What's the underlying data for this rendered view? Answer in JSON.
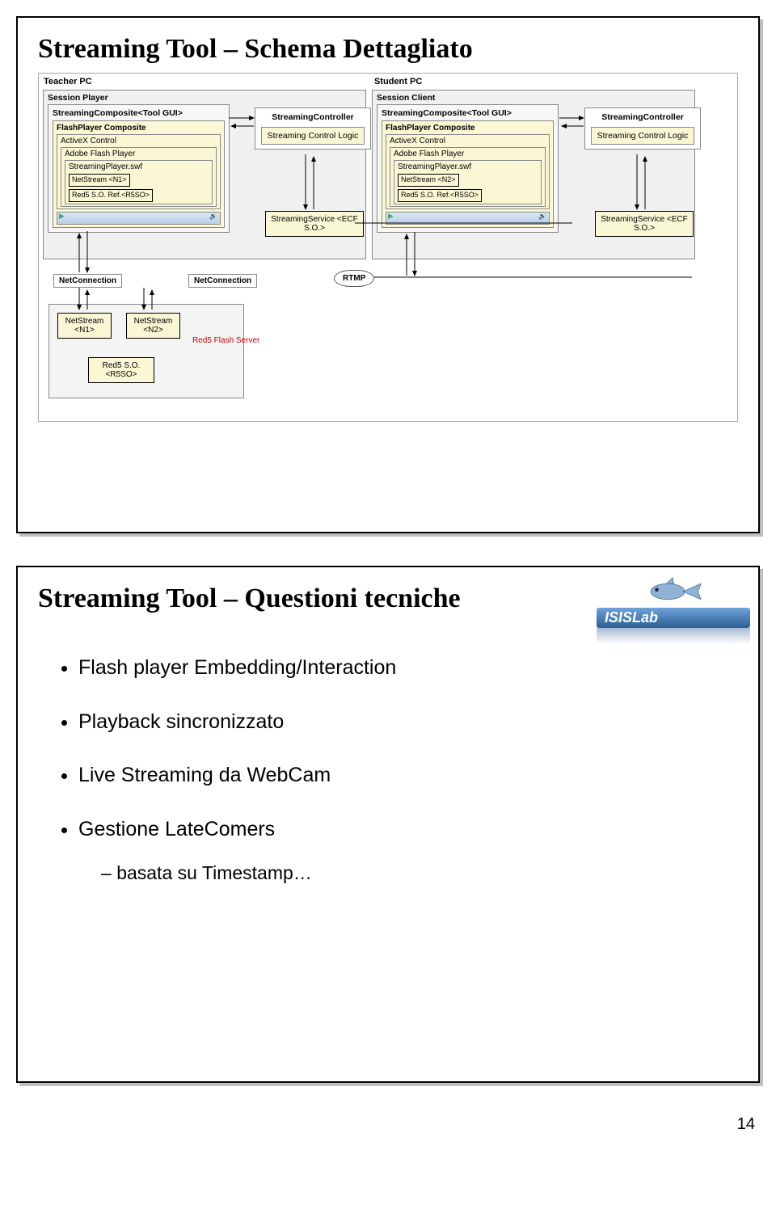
{
  "slide1": {
    "title": "Streaming Tool – Schema Dettagliato",
    "teacher_pc": "Teacher PC",
    "student_pc": "Student PC",
    "session_player": "Session Player",
    "session_client": "Session Client",
    "composite": "StreamingComposite<Tool GUI>",
    "flash_composite": "FlashPlayer Composite",
    "activex": "ActiveX Control",
    "flash_player": "Adobe Flash Player",
    "swf": "StreamingPlayer.swf",
    "netstream_n1": "NetStream <N1>",
    "netstream_n2": "NetStream <N2>",
    "red5_ref": "Red5 S.O. Ref.<R5SO>",
    "controller": "StreamingController",
    "control_logic": "Streaming Control Logic",
    "service": "StreamingService <ECF S.O.>",
    "netconnection": "NetConnection",
    "rtmp": "RTMP",
    "red5_so": "Red5 S.O. <R5SO>",
    "red5_server": "Red5 Flash Server"
  },
  "slide2": {
    "title": "Streaming Tool – Questioni tecniche",
    "brand": "ISISLab",
    "b1": "Flash player Embedding/Interaction",
    "b2": "Playback sincronizzato",
    "b3": "Live Streaming da WebCam",
    "b4": "Gestione LateComers",
    "b4_sub": "basata su Timestamp…"
  },
  "page": "14"
}
